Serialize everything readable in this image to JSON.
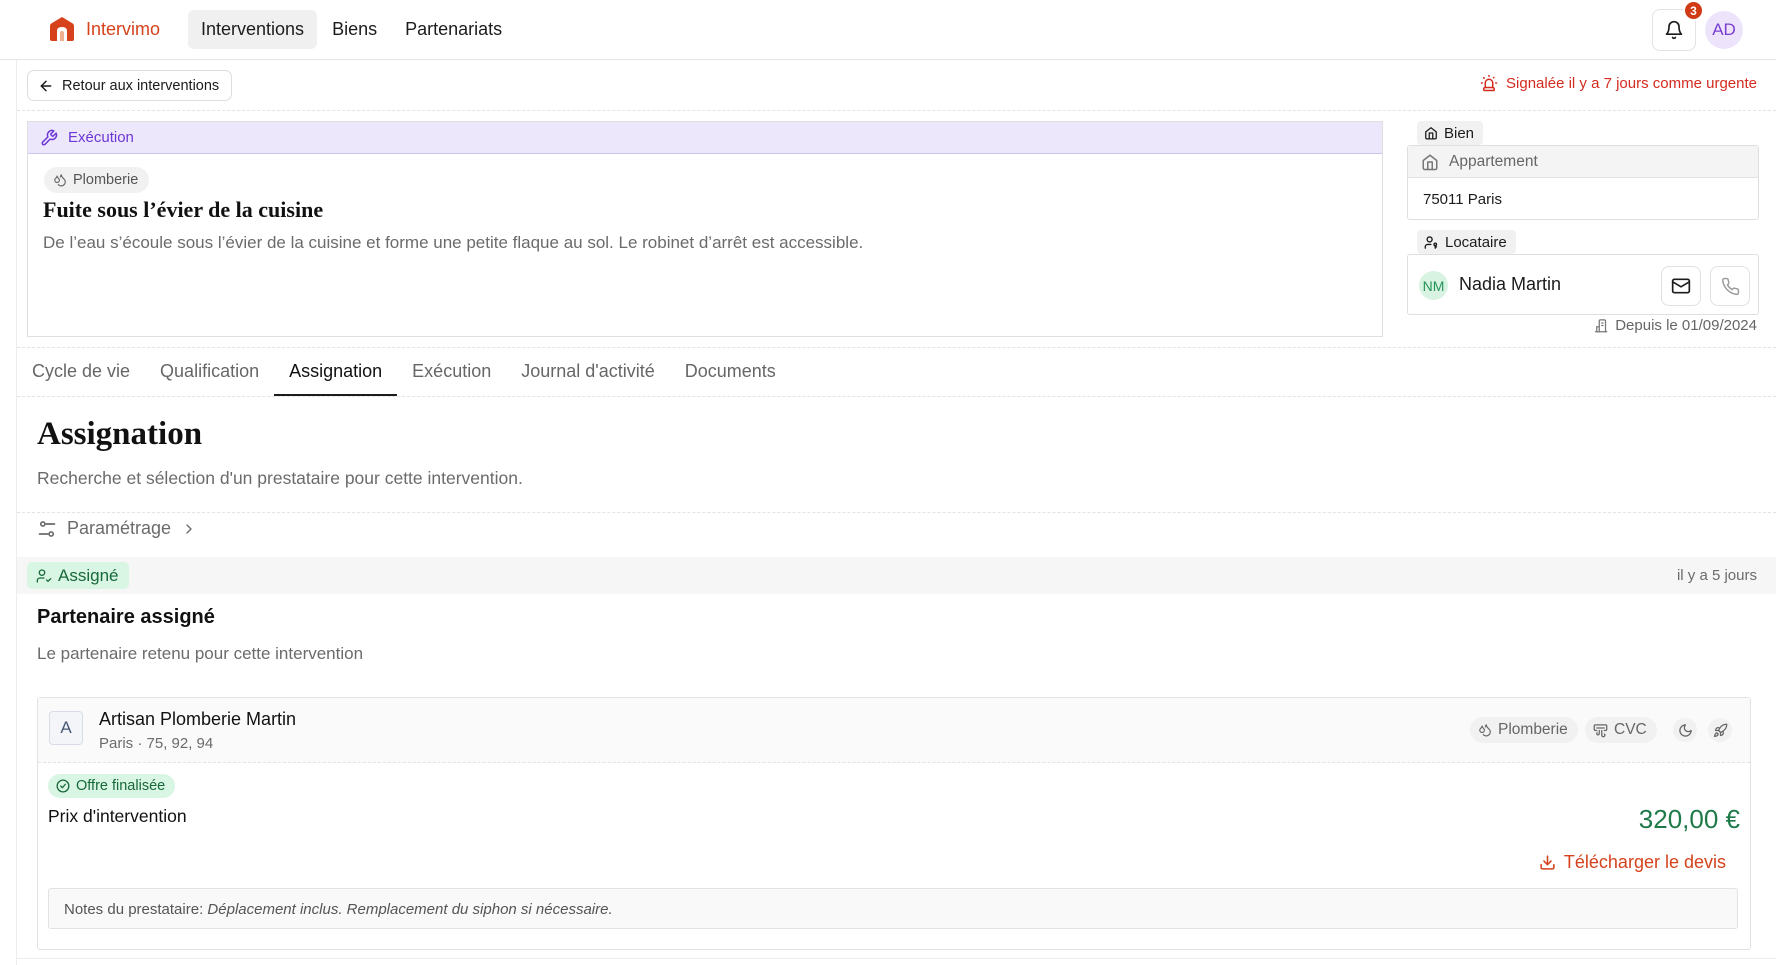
{
  "app": {
    "name": "Intervimo"
  },
  "nav": {
    "links": [
      "Interventions",
      "Biens",
      "Partenariats"
    ],
    "notifications_count": "3",
    "user_initials": "AD"
  },
  "back": {
    "label": "Retour aux interventions"
  },
  "urgent": {
    "label": "Signalée il y a 7 jours comme urgente"
  },
  "intervention": {
    "status": "Exécution",
    "category": "Plomberie",
    "title": "Fuite sous l’évier de la cuisine",
    "description": "De l’eau s’écoule sous l’évier de la cuisine et forme une petite flaque au sol. Le robinet d’arrêt est accessible."
  },
  "bien": {
    "tag": "Bien",
    "type": "Appartement",
    "city": "75011 Paris"
  },
  "locataire": {
    "tag": "Locataire",
    "initials": "NM",
    "name": "Nadia Martin",
    "since": "Depuis le 01/09/2024"
  },
  "tabs": [
    "Cycle de vie",
    "Qualification",
    "Assignation",
    "Exécution",
    "Journal d'activité",
    "Documents"
  ],
  "assignation": {
    "title": "Assignation",
    "subtitle": "Recherche et sélection d'un prestataire pour cette intervention.",
    "param_label": "Paramétrage",
    "status_label": "Assigné",
    "status_time": "il y a 5 jours",
    "partner_title": "Partenaire assigné",
    "partner_subtitle": "Le partenaire retenu pour cette intervention"
  },
  "provider": {
    "initial": "A",
    "name": "Artisan Plomberie Martin",
    "zone": "Paris · 75, 92, 94",
    "skills": [
      "Plomberie",
      "CVC"
    ],
    "offer_status": "Offre finalisée",
    "price_label": "Prix d'intervention",
    "price": "320,00 €",
    "download_label": "Télécharger le devis",
    "notes_label": "Notes du prestataire:",
    "notes": "Déplacement inclus. Remplacement du siphon si nécessaire."
  },
  "colors": {
    "brand": "#d5421c",
    "status_purple": "#6c37d6",
    "success_green": "#17683a",
    "urgent_red": "#d42b1e"
  }
}
